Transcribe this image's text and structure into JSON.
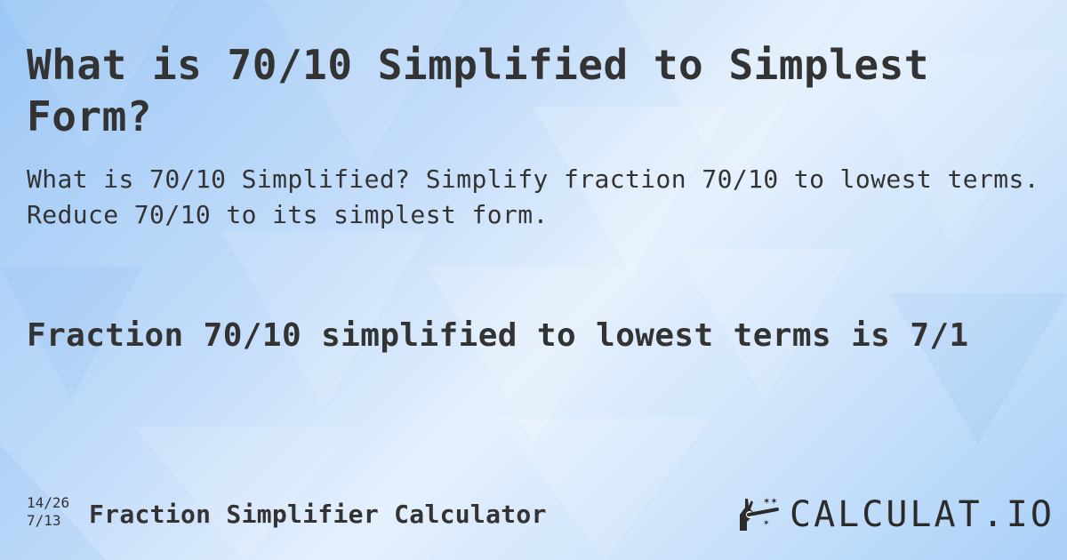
{
  "title": "What is 70/10 Simplified to Simplest Form?",
  "description": "What is 70/10 Simplified? Simplify fraction 70/10 to lowest terms. Reduce 70/10 to its simplest form.",
  "answer": "Fraction 70/10 simplified to lowest terms is 7/1",
  "footer": {
    "fraction_top": "14/26",
    "fraction_bottom": "7/13",
    "calculator_name": "Fraction Simplifier Calculator"
  },
  "logo": {
    "icon": "hand-magic-wand-icon",
    "text": "CALCULAT.IO"
  },
  "colors": {
    "text": "#333333",
    "background_light": "#e4f0fd",
    "background_dark": "#9cc7f5"
  }
}
